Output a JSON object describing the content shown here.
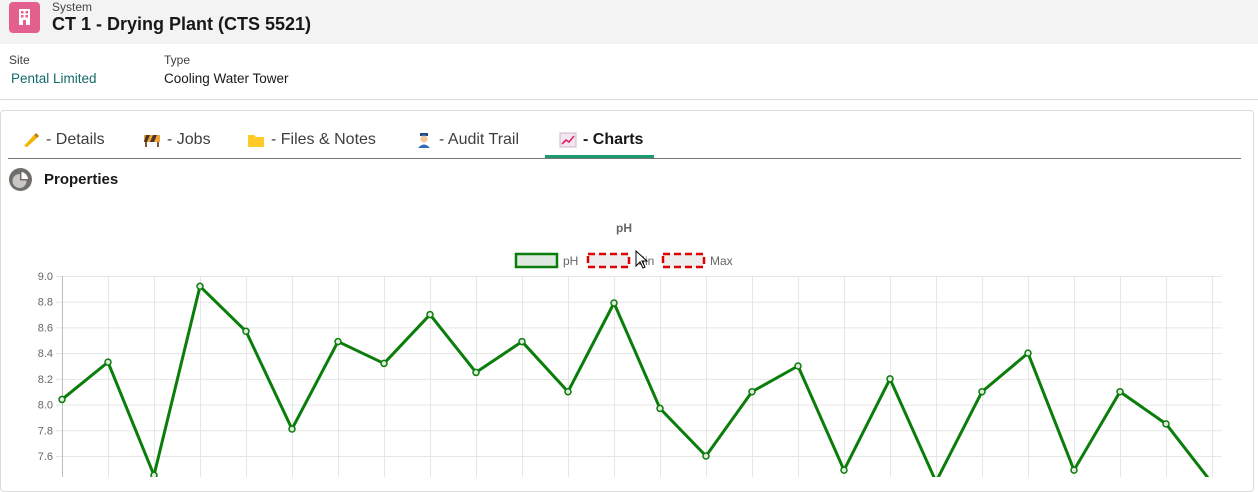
{
  "header": {
    "object_label": "System",
    "title": "CT 1 - Drying Plant (CTS 5521)"
  },
  "fields": {
    "site_label": "Site",
    "site_value": "Pental Limited",
    "type_label": "Type",
    "type_value": "Cooling Water Tower"
  },
  "tabs": [
    {
      "label": "- Details",
      "icon": "writing-hand-icon"
    },
    {
      "label": "- Jobs",
      "icon": "construction-barrier-icon"
    },
    {
      "label": "- Files & Notes",
      "icon": "folder-icon"
    },
    {
      "label": "- Audit Trail",
      "icon": "police-officer-icon"
    },
    {
      "label": "- Charts",
      "icon": "chart-increasing-icon",
      "active": true
    }
  ],
  "section": {
    "title": "Properties",
    "icon": "pie-chart-icon"
  },
  "colors": {
    "accent_tab": "#1b9b6e",
    "series_ph": "#0a7d0a",
    "series_limits": "#e00000",
    "header_bg": "#f3f3f3",
    "link_teal": "#116a6b"
  },
  "chart_data": {
    "type": "line",
    "title": "pH",
    "legend": [
      "pH",
      "Min",
      "Max"
    ],
    "legend_placement": "top-center",
    "y_ticks": [
      "9.0",
      "8.8",
      "8.6",
      "8.4",
      "8.2",
      "8.0",
      "7.8",
      "7.6"
    ],
    "ylim": [
      7.6,
      9.0
    ],
    "grid": true,
    "series": [
      {
        "name": "pH",
        "values": [
          8.04,
          8.33,
          7.45,
          8.92,
          8.57,
          7.81,
          8.49,
          8.32,
          8.7,
          8.25,
          8.49,
          8.1,
          8.79,
          7.97,
          7.6,
          8.1,
          8.3,
          7.49,
          8.2,
          7.4,
          8.1,
          8.4,
          7.49,
          8.1,
          7.85,
          7.39
        ]
      }
    ]
  }
}
